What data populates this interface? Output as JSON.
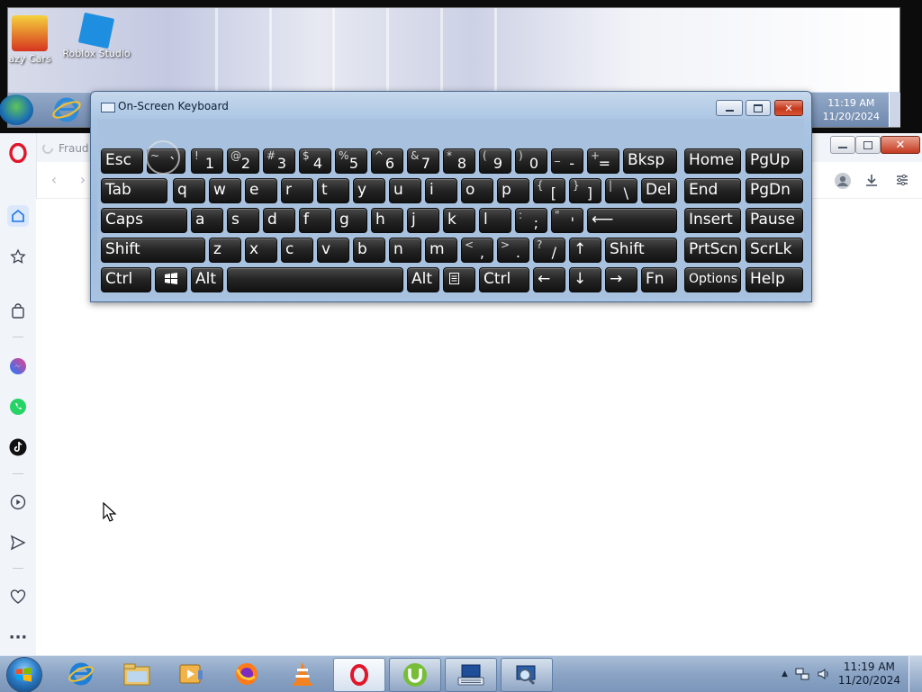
{
  "remote_desktop": {
    "icons": [
      {
        "label": "azy Cars",
        "icon": "game-car-icon"
      },
      {
        "label": "Roblox Studio",
        "icon": "roblox-studio-icon"
      }
    ],
    "clock_time": "11:19 AM",
    "clock_date": "11/20/2024"
  },
  "browser": {
    "tab_title": "Fraud",
    "sidebar_icons": [
      "opera-logo-icon",
      "home-icon",
      "star-icon",
      "shopping-bag-icon",
      "messenger-icon",
      "whatsapp-icon",
      "tiktok-icon",
      "player-icon",
      "send-icon",
      "heart-icon",
      "more-icon"
    ],
    "toolbar_icons": [
      "account-icon",
      "download-icon",
      "easy-setup-icon"
    ]
  },
  "osk": {
    "title": "On-Screen Keyboard",
    "rows": [
      [
        {
          "label": "Esc"
        },
        {
          "main": "`",
          "shift": "~"
        },
        {
          "main": "1",
          "shift": "!"
        },
        {
          "main": "2",
          "shift": "@"
        },
        {
          "main": "3",
          "shift": "#"
        },
        {
          "main": "4",
          "shift": "$"
        },
        {
          "main": "5",
          "shift": "%"
        },
        {
          "main": "6",
          "shift": "^"
        },
        {
          "main": "7",
          "shift": "&"
        },
        {
          "main": "8",
          "shift": "*"
        },
        {
          "main": "9",
          "shift": "("
        },
        {
          "main": "0",
          "shift": ")"
        },
        {
          "main": "-",
          "shift": "_"
        },
        {
          "main": "=",
          "shift": "+"
        },
        {
          "label": "Bksp"
        },
        {
          "label": "Home"
        },
        {
          "label": "PgUp"
        }
      ],
      [
        {
          "label": "Tab"
        },
        {
          "label": "q"
        },
        {
          "label": "w"
        },
        {
          "label": "e"
        },
        {
          "label": "r"
        },
        {
          "label": "t"
        },
        {
          "label": "y"
        },
        {
          "label": "u"
        },
        {
          "label": "i"
        },
        {
          "label": "o"
        },
        {
          "label": "p"
        },
        {
          "main": "[",
          "shift": "{"
        },
        {
          "main": "]",
          "shift": "}"
        },
        {
          "main": "\\",
          "shift": "|"
        },
        {
          "label": "Del"
        },
        {
          "label": "End"
        },
        {
          "label": "PgDn"
        }
      ],
      [
        {
          "label": "Caps"
        },
        {
          "label": "a"
        },
        {
          "label": "s"
        },
        {
          "label": "d"
        },
        {
          "label": "f"
        },
        {
          "label": "g"
        },
        {
          "label": "h"
        },
        {
          "label": "j"
        },
        {
          "label": "k"
        },
        {
          "label": "l"
        },
        {
          "main": ";",
          "shift": ":"
        },
        {
          "main": "'",
          "shift": "\""
        },
        {
          "label": "⟵"
        },
        {
          "label": "Insert"
        },
        {
          "label": "Pause"
        }
      ],
      [
        {
          "label": "Shift"
        },
        {
          "label": "z"
        },
        {
          "label": "x"
        },
        {
          "label": "c"
        },
        {
          "label": "v"
        },
        {
          "label": "b"
        },
        {
          "label": "n"
        },
        {
          "label": "m"
        },
        {
          "main": ",",
          "shift": "<"
        },
        {
          "main": ".",
          "shift": ">"
        },
        {
          "main": "/",
          "shift": "?"
        },
        {
          "label": "↑"
        },
        {
          "label": "Shift"
        },
        {
          "label": "PrtScn"
        },
        {
          "label": "ScrLk"
        }
      ],
      [
        {
          "label": "Ctrl"
        },
        {
          "label": "",
          "icon": "windows-logo-icon"
        },
        {
          "label": "Alt"
        },
        {
          "label": ""
        },
        {
          "label": "Alt"
        },
        {
          "label": "",
          "icon": "menu-key-icon"
        },
        {
          "label": "Ctrl"
        },
        {
          "label": "←"
        },
        {
          "label": "↓"
        },
        {
          "label": "→"
        },
        {
          "label": "Fn"
        },
        {
          "label": "Options"
        },
        {
          "label": "Help"
        }
      ]
    ]
  },
  "taskbar": {
    "apps": [
      "internet-explorer-icon",
      "file-explorer-icon",
      "media-player-icon",
      "firefox-icon",
      "vlc-icon",
      "opera-icon",
      "utorrent-icon",
      "on-screen-keyboard-icon",
      "magnifier-icon"
    ],
    "clock_time": "11:19 AM",
    "clock_date": "11/20/2024"
  }
}
